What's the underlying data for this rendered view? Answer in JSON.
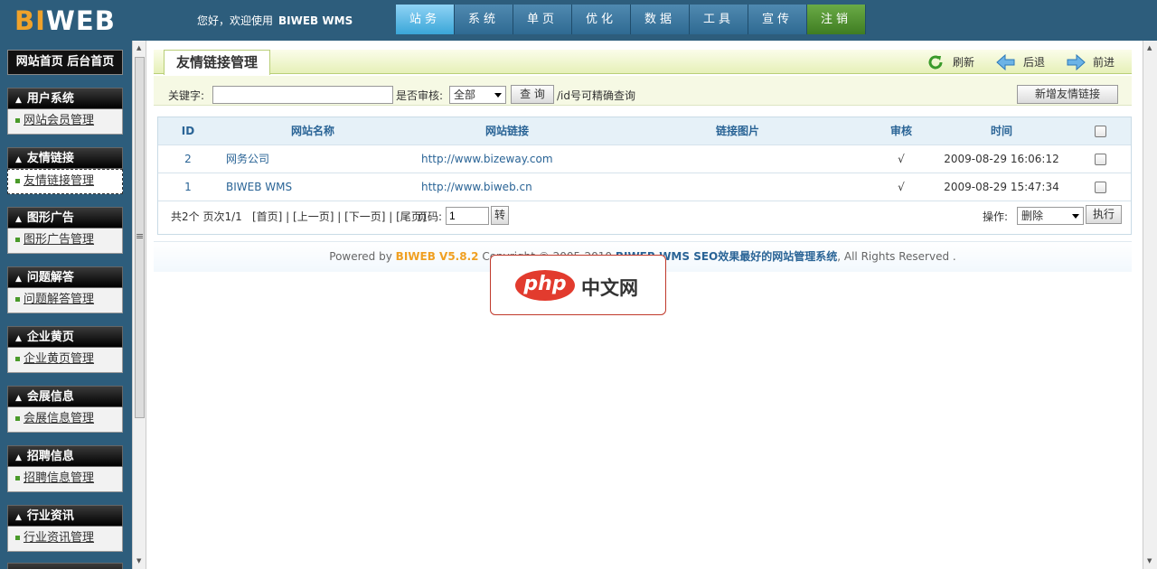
{
  "header": {
    "logo_bi": "BI",
    "logo_web": "WEB",
    "welcome": "您好，欢迎使用",
    "product": "BIWEB WMS",
    "nav": [
      {
        "label": "站务",
        "active": true
      },
      {
        "label": "系统"
      },
      {
        "label": "单页"
      },
      {
        "label": "优化"
      },
      {
        "label": "数据"
      },
      {
        "label": "工具"
      },
      {
        "label": "宣传"
      },
      {
        "label": "注销",
        "logout": true
      }
    ]
  },
  "sidebar": {
    "top_links": "网站首页  后台首页",
    "groups": [
      {
        "title": "用户系统",
        "item": "网站会员管理"
      },
      {
        "title": "友情链接",
        "item": "友情链接管理",
        "active": true
      },
      {
        "title": "图形广告",
        "item": "图形广告管理"
      },
      {
        "title": "问题解答",
        "item": "问题解答管理"
      },
      {
        "title": "企业黄页",
        "item": "企业黄页管理"
      },
      {
        "title": "会展信息",
        "item": "会展信息管理"
      },
      {
        "title": "招聘信息",
        "item": "招聘信息管理"
      },
      {
        "title": "行业资讯",
        "item": "行业资讯管理"
      }
    ]
  },
  "page": {
    "title": "友情链接管理",
    "refresh": "刷新",
    "back": "后退",
    "forward": "前进"
  },
  "search": {
    "keyword_label": "关键字:",
    "keyword_value": "",
    "audit_label": "是否审核:",
    "audit_selected": "全部",
    "query_button": "查 询",
    "hint": "/id号可精确查询",
    "add_button": "新增友情链接"
  },
  "table": {
    "columns": [
      "ID",
      "网站名称",
      "网站链接",
      "链接图片",
      "审核",
      "时间"
    ],
    "rows": [
      {
        "id": "2",
        "name": "网务公司",
        "url": "http://www.bizeway.com",
        "image": "",
        "audit": "√",
        "time": "2009-08-29 16:06:12"
      },
      {
        "id": "1",
        "name": "BIWEB WMS",
        "url": "http://www.biweb.cn",
        "image": "",
        "audit": "√",
        "time": "2009-08-29 15:47:34"
      }
    ]
  },
  "pager": {
    "summary": "共2个  页次1/1",
    "links": "[首页] | [上一页] | [下一页] | [尾页]",
    "page_label": "页码:",
    "page_value": "1",
    "go_button": "转",
    "op_label": "操作:",
    "op_selected": "删除",
    "exec_button": "执行"
  },
  "footer": {
    "powered": "Powered by",
    "version": "BIWEB V5.8.2",
    "copyright": "Copyright © 2005-2010",
    "brand": "BIWEB WMS SEO效果最好的网站管理系统",
    "rights": ", All Rights Reserved ."
  },
  "watermark": {
    "php": "php",
    "cn": "中文网"
  }
}
